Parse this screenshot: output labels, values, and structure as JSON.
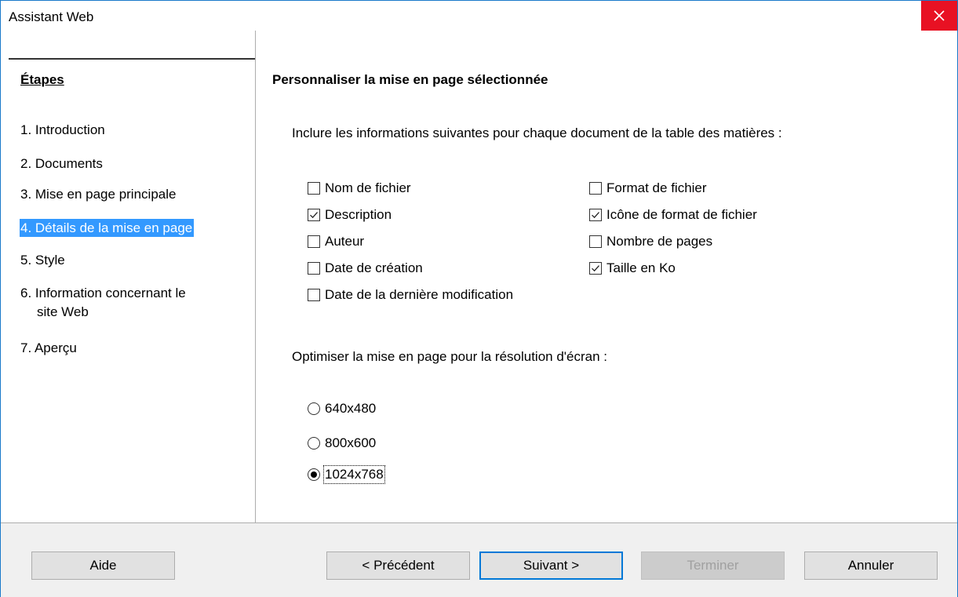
{
  "window": {
    "title": "Assistant Web"
  },
  "sidebar": {
    "heading": "Étapes",
    "steps": [
      {
        "label": "1. Introduction"
      },
      {
        "label": "2. Documents"
      },
      {
        "label": "3. Mise en page principale"
      },
      {
        "label": "4. Détails de la mise en page",
        "selected": true
      },
      {
        "label": "5. Style"
      },
      {
        "label": "6. Information concernant le"
      },
      {
        "label": "site Web"
      },
      {
        "label": "7. Aperçu"
      }
    ]
  },
  "content": {
    "title": "Personnaliser la mise en page sélectionnée",
    "info_label": "Inclure les informations suivantes pour chaque document de la table des matières :",
    "checkboxes": {
      "filename": {
        "label": "Nom de fichier",
        "checked": false
      },
      "description": {
        "label": "Description",
        "checked": true
      },
      "author": {
        "label": "Auteur",
        "checked": false
      },
      "created": {
        "label": "Date de création",
        "checked": false
      },
      "modified": {
        "label": "Date de la dernière modification",
        "checked": false
      },
      "format": {
        "label": "Format de fichier",
        "checked": false
      },
      "format_icon": {
        "label": "Icône de format de fichier",
        "checked": true
      },
      "pages": {
        "label": "Nombre de pages",
        "checked": false
      },
      "size": {
        "label": "Taille en Ko",
        "checked": true
      }
    },
    "optimize_label": "Optimiser la mise en page pour la résolution d'écran :",
    "radios": {
      "r640": {
        "label": "640x480",
        "selected": false
      },
      "r800": {
        "label": "800x600",
        "selected": false
      },
      "r1024": {
        "label": "1024x768",
        "selected": true
      }
    }
  },
  "footer": {
    "help": "Aide",
    "previous": "< Précédent",
    "next": "Suivant >",
    "finish": "Terminer",
    "cancel": "Annuler"
  },
  "colors": {
    "selection": "#3399ff",
    "close": "#e81123",
    "default_border": "#0078d7"
  }
}
